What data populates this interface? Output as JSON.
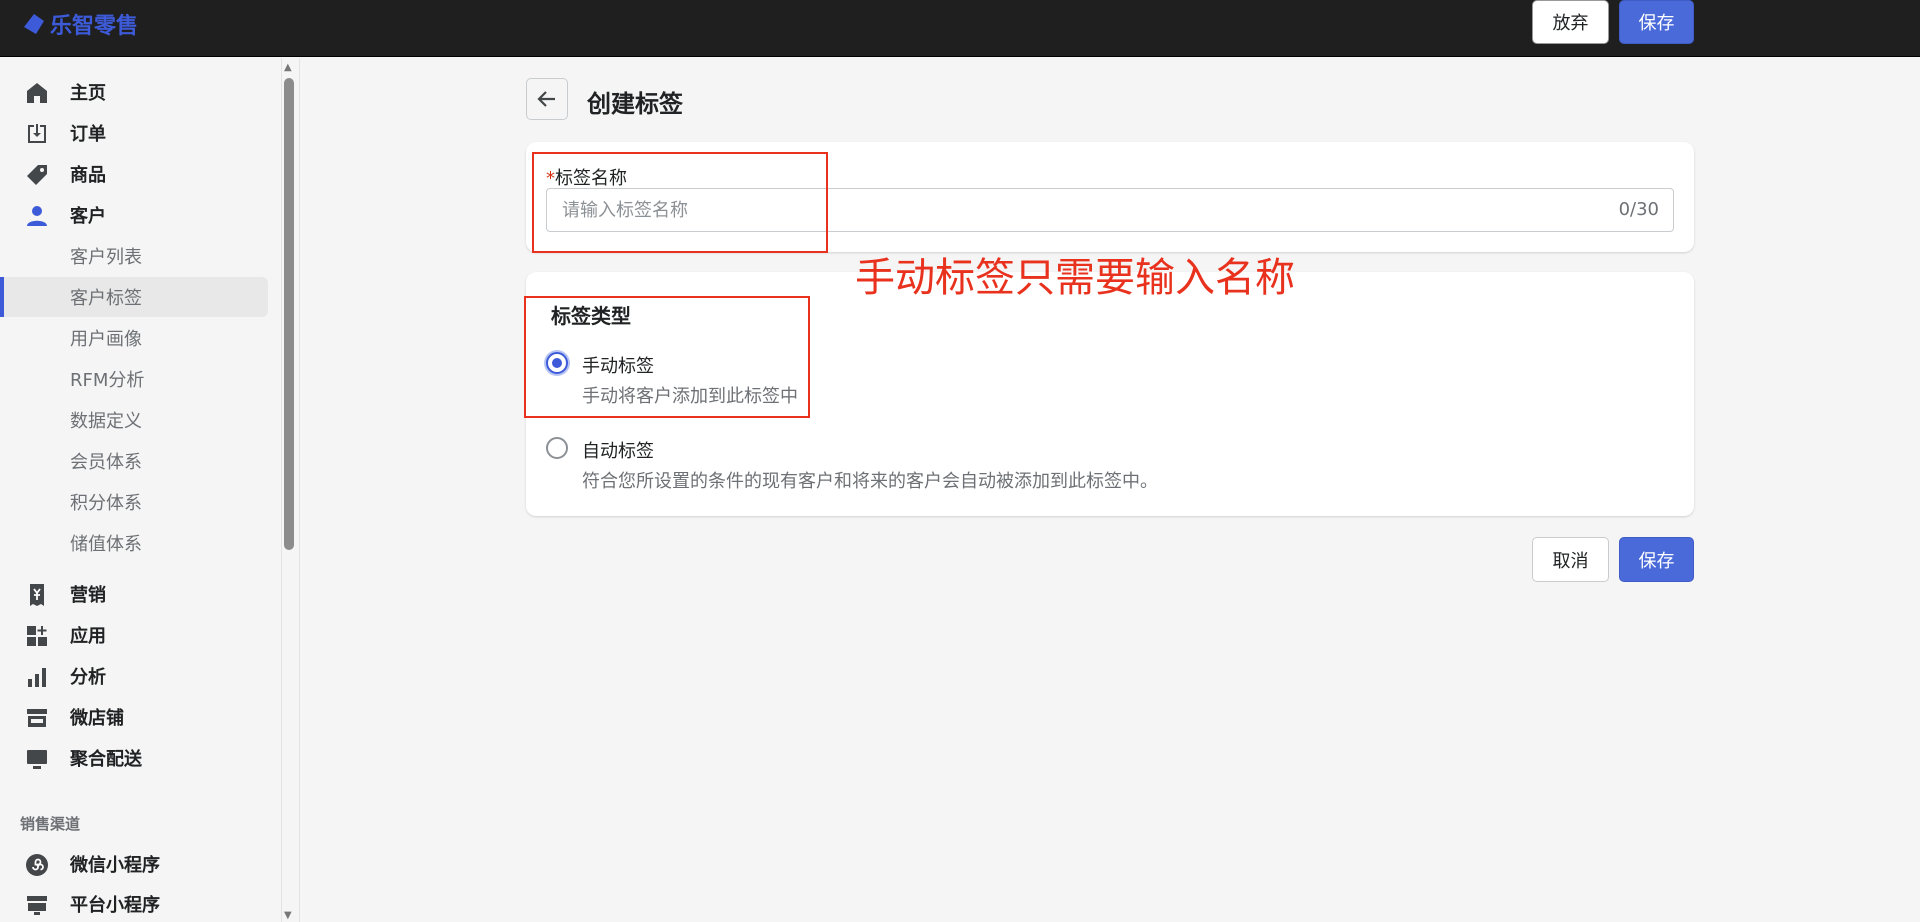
{
  "app": {
    "brand": "乐智零售"
  },
  "topbar": {
    "discard_label": "放弃",
    "save_label": "保存"
  },
  "sidebar": {
    "items": [
      {
        "label": "主页",
        "icon": "home-icon"
      },
      {
        "label": "订单",
        "icon": "order-inbox-icon"
      },
      {
        "label": "商品",
        "icon": "tag-icon"
      },
      {
        "label": "客户",
        "icon": "person-icon"
      }
    ],
    "customer_sub": [
      {
        "label": "客户列表"
      },
      {
        "label": "客户标签"
      },
      {
        "label": "用户画像"
      },
      {
        "label": "RFM分析"
      },
      {
        "label": "数据定义"
      },
      {
        "label": "会员体系"
      },
      {
        "label": "积分体系"
      },
      {
        "label": "储值体系"
      }
    ],
    "items2": [
      {
        "label": "营销",
        "icon": "receipt-yen-icon"
      },
      {
        "label": "应用",
        "icon": "apps-add-icon"
      },
      {
        "label": "分析",
        "icon": "bar-chart-icon"
      },
      {
        "label": "微店铺",
        "icon": "store-icon"
      },
      {
        "label": "聚合配送",
        "icon": "monitor-icon"
      }
    ],
    "section_label": "销售渠道",
    "channels": [
      {
        "label": "微信小程序",
        "icon": "mini-program-icon"
      },
      {
        "label": "平台小程序",
        "icon": "platform-icon"
      }
    ]
  },
  "page": {
    "title": "创建标签"
  },
  "name_field": {
    "required_mark": "*",
    "label": "标签名称",
    "value": "",
    "placeholder": "请输入标签名称",
    "counter": "0/30"
  },
  "tag_type": {
    "title": "标签类型",
    "options": [
      {
        "label": "手动标签",
        "help": "手动将客户添加到此标签中",
        "checked": true
      },
      {
        "label": "自动标签",
        "help": "符合您所设置的条件的现有客户和将来的客户会自动被添加到此标签中。",
        "checked": false
      }
    ]
  },
  "actions": {
    "cancel_label": "取消",
    "save_label": "保存"
  },
  "annotation": {
    "text": "手动标签只需要输入名称",
    "color": "#e8321e"
  },
  "colors": {
    "accent": "#3d5bd9",
    "primary_button": "#4a6ad9",
    "topbar": "#1f1f1f"
  }
}
